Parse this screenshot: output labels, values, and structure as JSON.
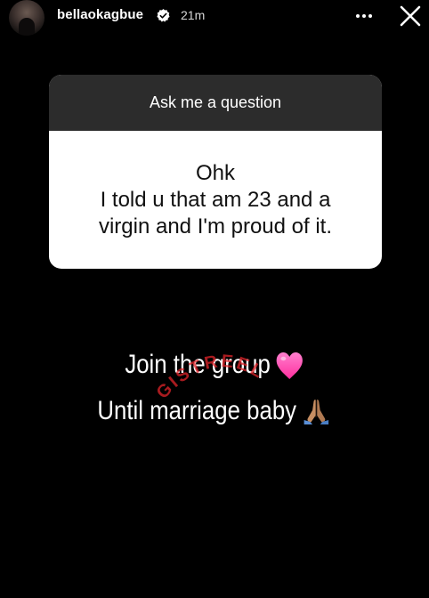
{
  "header": {
    "username": "bellaokagbue",
    "time": "21m",
    "verified": true
  },
  "question_sticker": {
    "prompt": "Ask me a question",
    "answer_lines": [
      "Ohk",
      "I told u that am 23 and a",
      "virgin and I'm proud of it."
    ]
  },
  "caption": {
    "line1": "Join the group",
    "line2": "Until marriage baby"
  },
  "watermark": {
    "text": "GISTREEL"
  },
  "colors": {
    "background": "#000000",
    "sticker_header": "#2c2c2c",
    "sticker_body": "#ffffff",
    "heart": "#ff4fb4",
    "watermark": "#e0242a"
  },
  "icons": [
    "verified-badge-icon",
    "more-options-icon",
    "close-icon",
    "pink-heart-emoji-icon",
    "praying-hands-emoji-icon"
  ]
}
